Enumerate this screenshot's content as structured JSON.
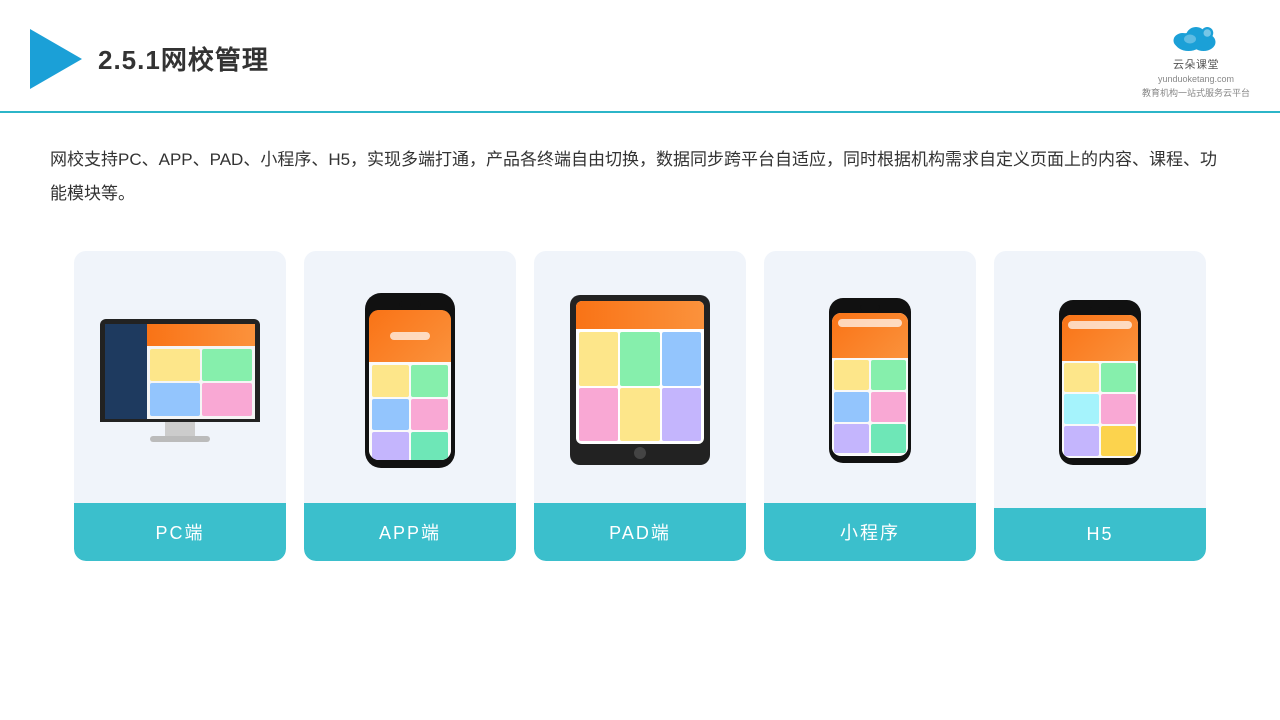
{
  "header": {
    "title": "2.5.1网校管理",
    "brand": {
      "name": "云朵课堂",
      "url": "yunduoketang.com",
      "tagline": "教育机构一站式服务云平台"
    }
  },
  "description": "网校支持PC、APP、PAD、小程序、H5，实现多端打通，产品各终端自由切换，数据同步跨平台自适应，同时根据机构需求自定义页面上的内容、课程、功能模块等。",
  "cards": [
    {
      "id": "pc",
      "label": "PC端"
    },
    {
      "id": "app",
      "label": "APP端"
    },
    {
      "id": "pad",
      "label": "PAD端"
    },
    {
      "id": "mini",
      "label": "小程序"
    },
    {
      "id": "h5",
      "label": "H5"
    }
  ],
  "colors": {
    "accent": "#3bbfcc",
    "primary": "#1ba0d7",
    "border": "#2cb5c8"
  }
}
